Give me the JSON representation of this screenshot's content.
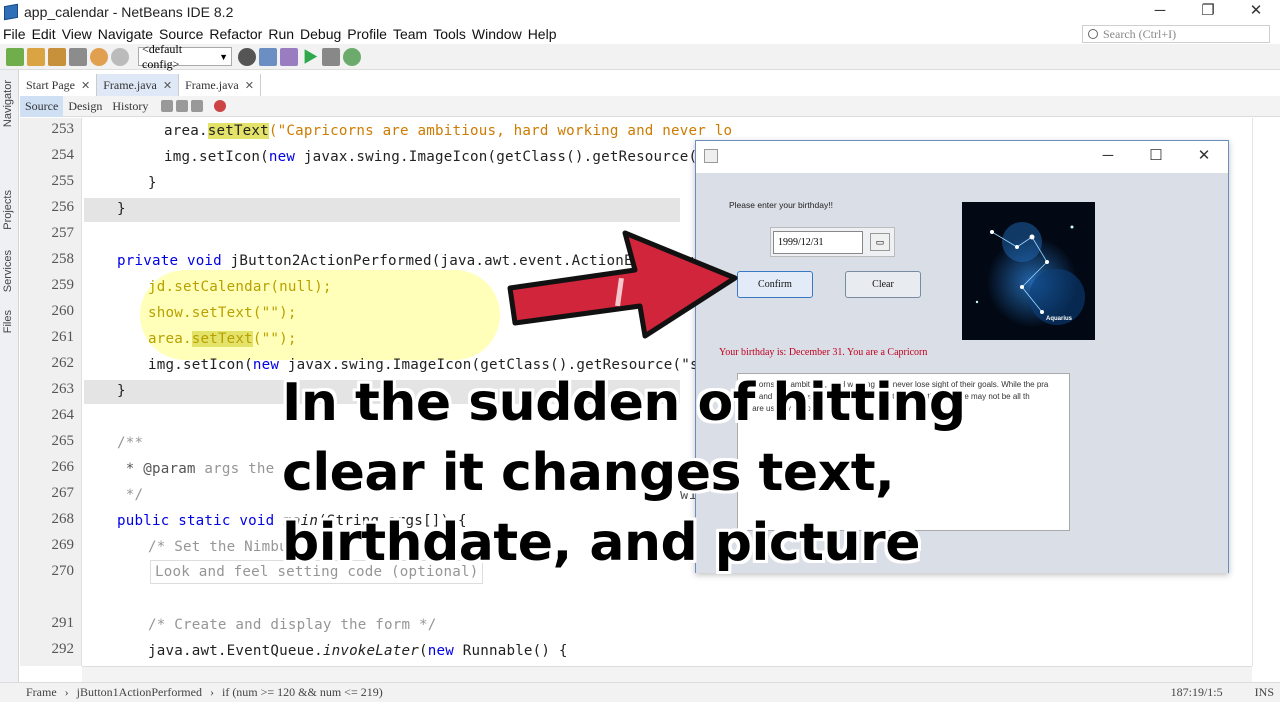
{
  "window": {
    "title": "app_calendar - NetBeans IDE 8.2"
  },
  "menu": [
    "File",
    "Edit",
    "View",
    "Navigate",
    "Source",
    "Refactor",
    "Run",
    "Debug",
    "Profile",
    "Team",
    "Tools",
    "Window",
    "Help"
  ],
  "search": {
    "placeholder": "Search (Ctrl+I)"
  },
  "toolbar": {
    "config_value": "<default config>"
  },
  "side_tabs": [
    "Navigator",
    "Projects",
    "Services",
    "Files"
  ],
  "editor_tabs": [
    {
      "label": "Start Page"
    },
    {
      "label": "Frame.java"
    },
    {
      "label": "Frame.java"
    }
  ],
  "editor_subtabs": [
    "Source",
    "Design",
    "History"
  ],
  "code_lines": [
    {
      "n": "253"
    },
    {
      "n": "254"
    },
    {
      "n": "255"
    },
    {
      "n": "256"
    },
    {
      "n": "257"
    },
    {
      "n": "258"
    },
    {
      "n": "259"
    },
    {
      "n": "260"
    },
    {
      "n": "261"
    },
    {
      "n": "262"
    },
    {
      "n": "263"
    },
    {
      "n": "264"
    },
    {
      "n": "265"
    },
    {
      "n": "266"
    },
    {
      "n": "267"
    },
    {
      "n": "268"
    },
    {
      "n": "269"
    },
    {
      "n": "270"
    },
    {
      "n": "291"
    },
    {
      "n": "292"
    }
  ],
  "code_text": {
    "l253a": "area.",
    "l253b": "setText",
    "l253c": "(\"Capricorns are ambitious, hard working and never lo",
    "l254a": "img.setIcon(",
    "l254b": "new",
    "l254c": " javax.swing.ImageIcon(getClass().getResource(\"12",
    "l255": "}",
    "l256": "}",
    "l258a": "private",
    "l258b": " ",
    "l258c": "void",
    "l258d": " jButton2ActionPerformed(java.awt.event.ActionEvent evt",
    "l259": "jd.setCalendar(null);",
    "l260": "show.setText(\"\");",
    "l261a": "area.",
    "l261b": "setText",
    "l261c": "(\"\");",
    "l262a": "img.setIcon(",
    "l262b": "new",
    "l262c": " javax.swing.ImageIcon(getClass().getResource(\"star",
    "l263": "}",
    "l265": "/**",
    "l266a": " * @param",
    "l266b": " args the co",
    "l267": " */",
    "l268a": "public",
    "l268b": "static",
    "l268c": "void",
    "l268d": "main",
    "l268e": "(String args[]) {",
    "l269": "/* Set the Nimbus",
    "l270": "Look and feel setting code (optional)",
    "l292a": "/* Create and display the form */",
    "l293a": "java.awt.EventQueue.",
    "l293b": "invokeLater",
    "l293c": "(",
    "l293d": "new",
    "l293e": " Runnable() {",
    "stray": "wi"
  },
  "statusbar": {
    "crumb1": "Frame",
    "crumb2": "jButton1ActionPerformed",
    "crumb3": "if (num >= 120 && num <= 219)",
    "position": "187:19/1:5",
    "mode": "INS"
  },
  "dialog": {
    "prompt": "Please enter your birthday!!",
    "date_value": "1999/12/31",
    "confirm_label": "Confirm",
    "clear_label": "Clear",
    "image_caption": "Aquarius",
    "birthday_result": "Your birthday is: December 31. You are a Capricorn",
    "textarea_line1": "pricorns are ambitious, hard working and never lose sight of their goals. While the pra",
    "textarea_line2": "ble and sometimes pessimistic approach to getting things done may not be all th",
    "textarea_line3": "y are usually the ones"
  },
  "overlay": {
    "line1": "In the sudden of hitting",
    "line2": "clear it changes text,",
    "line3": "birthdate, and picture"
  },
  "colors": {
    "keyword": "#0000e6",
    "string": "#ce7b00",
    "result_text": "#c00020",
    "arrow": "#d0253a"
  }
}
